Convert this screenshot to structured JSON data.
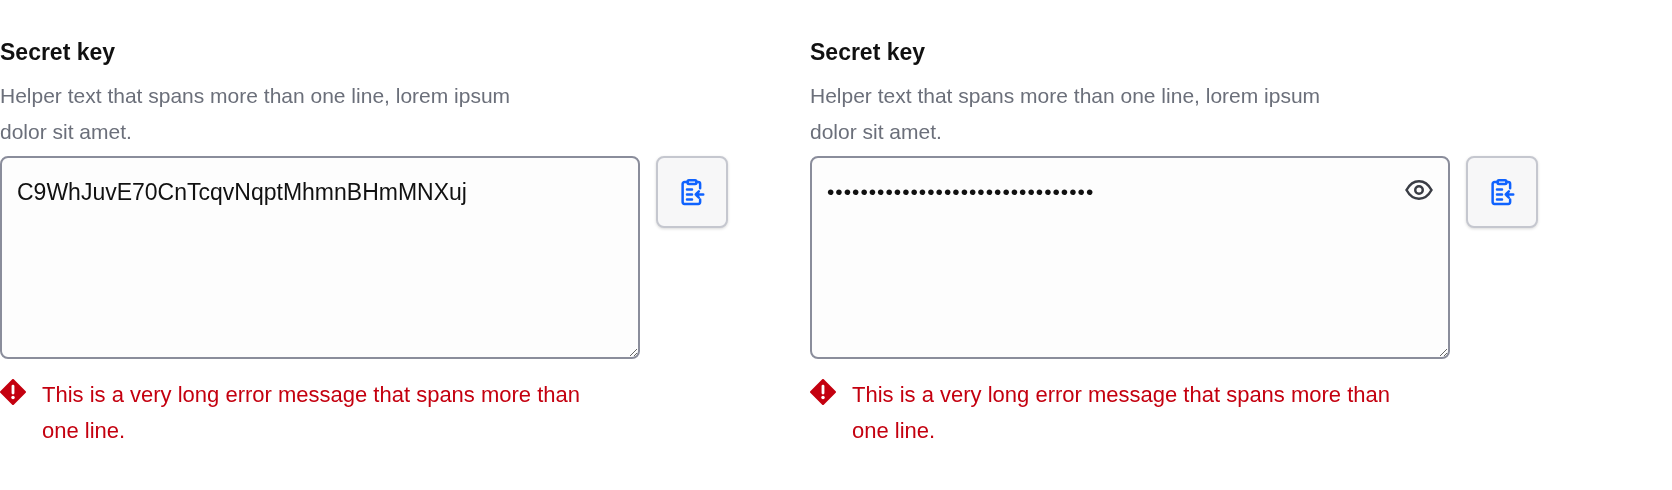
{
  "fields": [
    {
      "label": "Secret key",
      "helper": "Helper text that spans more than one line, lorem ipsum dolor sit amet.",
      "value": "C9WhJuvE70CnTcqvNqptMhmnBHmMNXuj",
      "masked": false,
      "error": "This is a very long error message that spans more than one line."
    },
    {
      "label": "Secret key",
      "helper": "Helper text that spans more than one line, lorem ipsum dolor sit amet.",
      "value": "••••••••••••••••••••••••••••••••",
      "masked": true,
      "error": "This is a very long error message that spans more than one line."
    }
  ]
}
